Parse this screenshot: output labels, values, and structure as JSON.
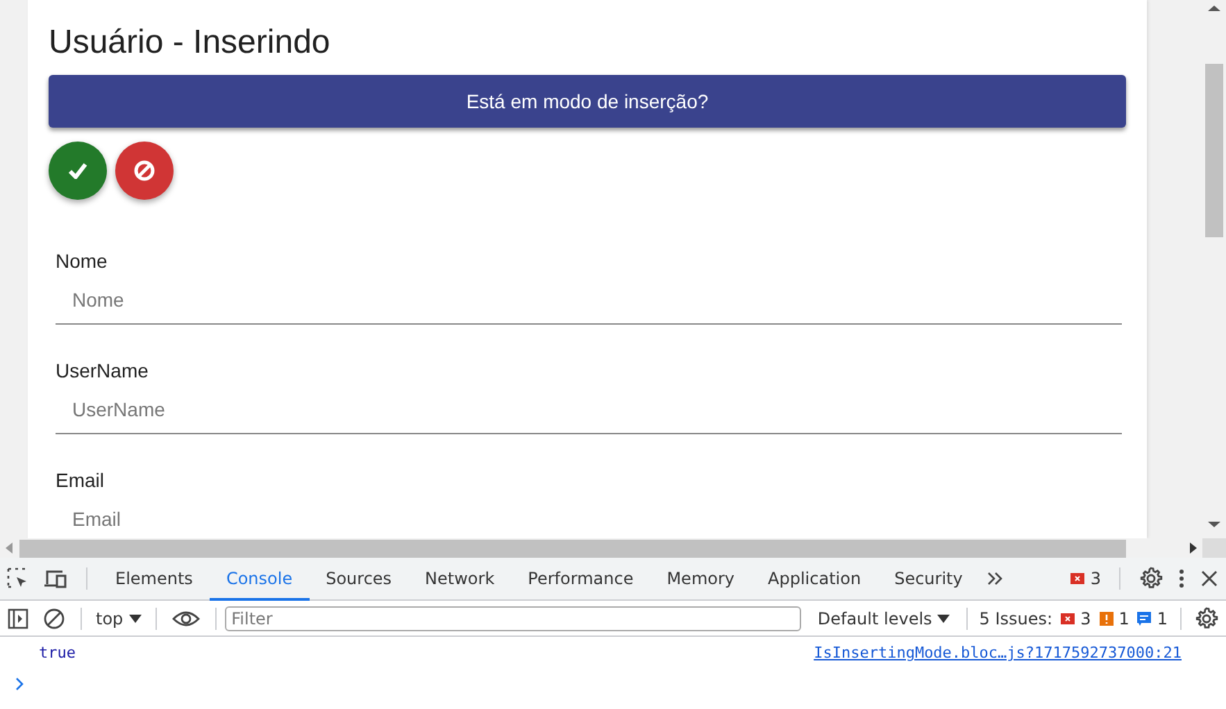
{
  "page": {
    "title": "Usuário - Inserindo",
    "banner": "Está em modo de inserção?",
    "action_buttons": [
      {
        "kind": "confirm"
      },
      {
        "kind": "cancel"
      }
    ],
    "fields": [
      {
        "label": "Nome",
        "placeholder": "Nome"
      },
      {
        "label": "UserName",
        "placeholder": "UserName"
      },
      {
        "label": "Email",
        "placeholder": "Email"
      }
    ]
  },
  "devtools": {
    "tabs": [
      {
        "label": "Elements",
        "selected": false
      },
      {
        "label": "Console",
        "selected": true
      },
      {
        "label": "Sources",
        "selected": false
      },
      {
        "label": "Network",
        "selected": false
      },
      {
        "label": "Performance",
        "selected": false
      },
      {
        "label": "Memory",
        "selected": false
      },
      {
        "label": "Application",
        "selected": false
      },
      {
        "label": "Security",
        "selected": false
      }
    ],
    "error_count": "3",
    "context": "top",
    "filter_placeholder": "Filter",
    "levels": "Default levels",
    "issues_label": "5 Issues:",
    "issue_counts": [
      {
        "kind": "error",
        "count": "3"
      },
      {
        "kind": "warning",
        "count": "1"
      },
      {
        "kind": "info",
        "count": "1"
      }
    ],
    "messages": [
      {
        "text": "true",
        "source": "IsInsertingMode.bloc…js?1717592737000:21"
      }
    ]
  }
}
